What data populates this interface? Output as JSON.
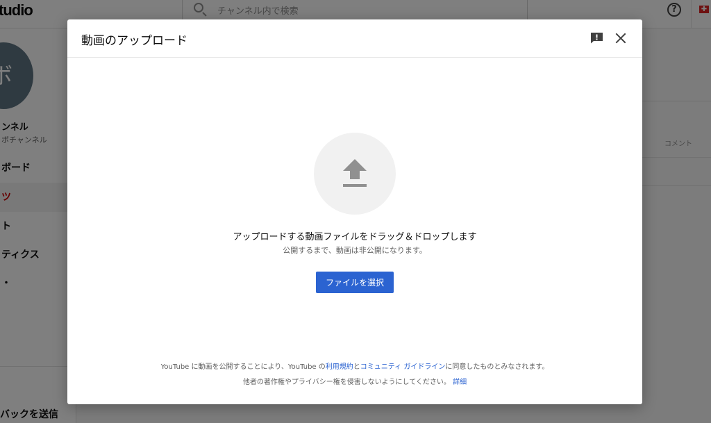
{
  "app": {
    "logo_text": "tudio",
    "search_placeholder": "チャンネル内で検索",
    "help_glyph": "?",
    "flag_glyph": "✚"
  },
  "sidebar": {
    "avatar_glyph": "ボ",
    "channel_name": "ンネル",
    "channel_sub": "ボチャンネル",
    "items": [
      {
        "label": "ボード"
      },
      {
        "label": "ツ"
      },
      {
        "label": "ト"
      },
      {
        "label": "ティクス"
      },
      {
        "label": "・"
      }
    ],
    "feedback": "バックを送信"
  },
  "main": {
    "column_comment": "コメント"
  },
  "dialog": {
    "title": "動画のアップロード",
    "drop_text": "アップロードする動画ファイルをドラッグ＆ドロップします",
    "drop_sub": "公開するまで、動画は非公開になります。",
    "select_button": "ファイルを選択",
    "terms": {
      "prefix": "YouTube に動画を公開することにより、YouTube の",
      "link_terms": "利用規約",
      "and": "と",
      "link_guidelines": "コミュニティ ガイドライン",
      "suffix": "に同意したものとみなされます。"
    },
    "privacy": {
      "text": "他者の著作権やプライバシー権を侵害しないようにしてください。",
      "link_details": "詳細"
    }
  },
  "colors": {
    "accent": "#2b63d1",
    "overlay": "rgba(0,0,0,0.5)",
    "active_nav": "#cc0000"
  }
}
